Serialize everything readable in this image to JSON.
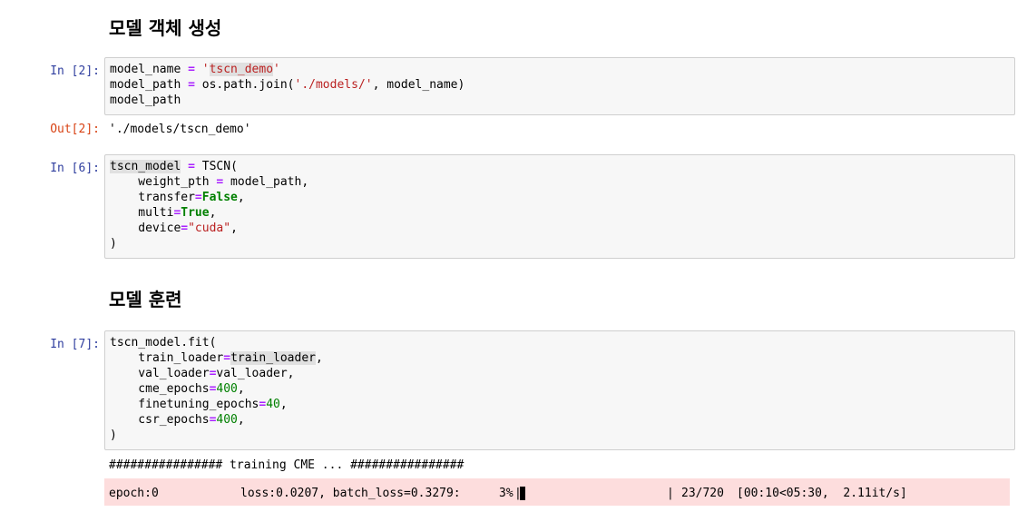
{
  "headings": {
    "create_model": "모델 객체 생성",
    "train_model": "모델 훈련"
  },
  "cells": {
    "c2": {
      "prompt_in": "In [2]:",
      "prompt_out": "Out[2]:",
      "output": "'./models/tscn_demo'"
    },
    "c6": {
      "prompt_in": "In [6]:"
    },
    "c7": {
      "prompt_in": "In [7]:",
      "output_line": "################ training CME ... ################"
    }
  },
  "progress": {
    "epoch_label": "epoch:0",
    "loss_text": "loss:0.0207, batch_loss=0.3279:",
    "percent": "3%",
    "percent_value": 3,
    "count": "23/720",
    "timing": "[00:10<05:30,  2.11it/s]",
    "highlight_color": "#fddddd"
  },
  "colors": {
    "prompt_in": "#303f9f",
    "prompt_out": "#d84315",
    "string": "#ba2121",
    "keyword_op": "#aa22ff",
    "constant": "#008000"
  }
}
